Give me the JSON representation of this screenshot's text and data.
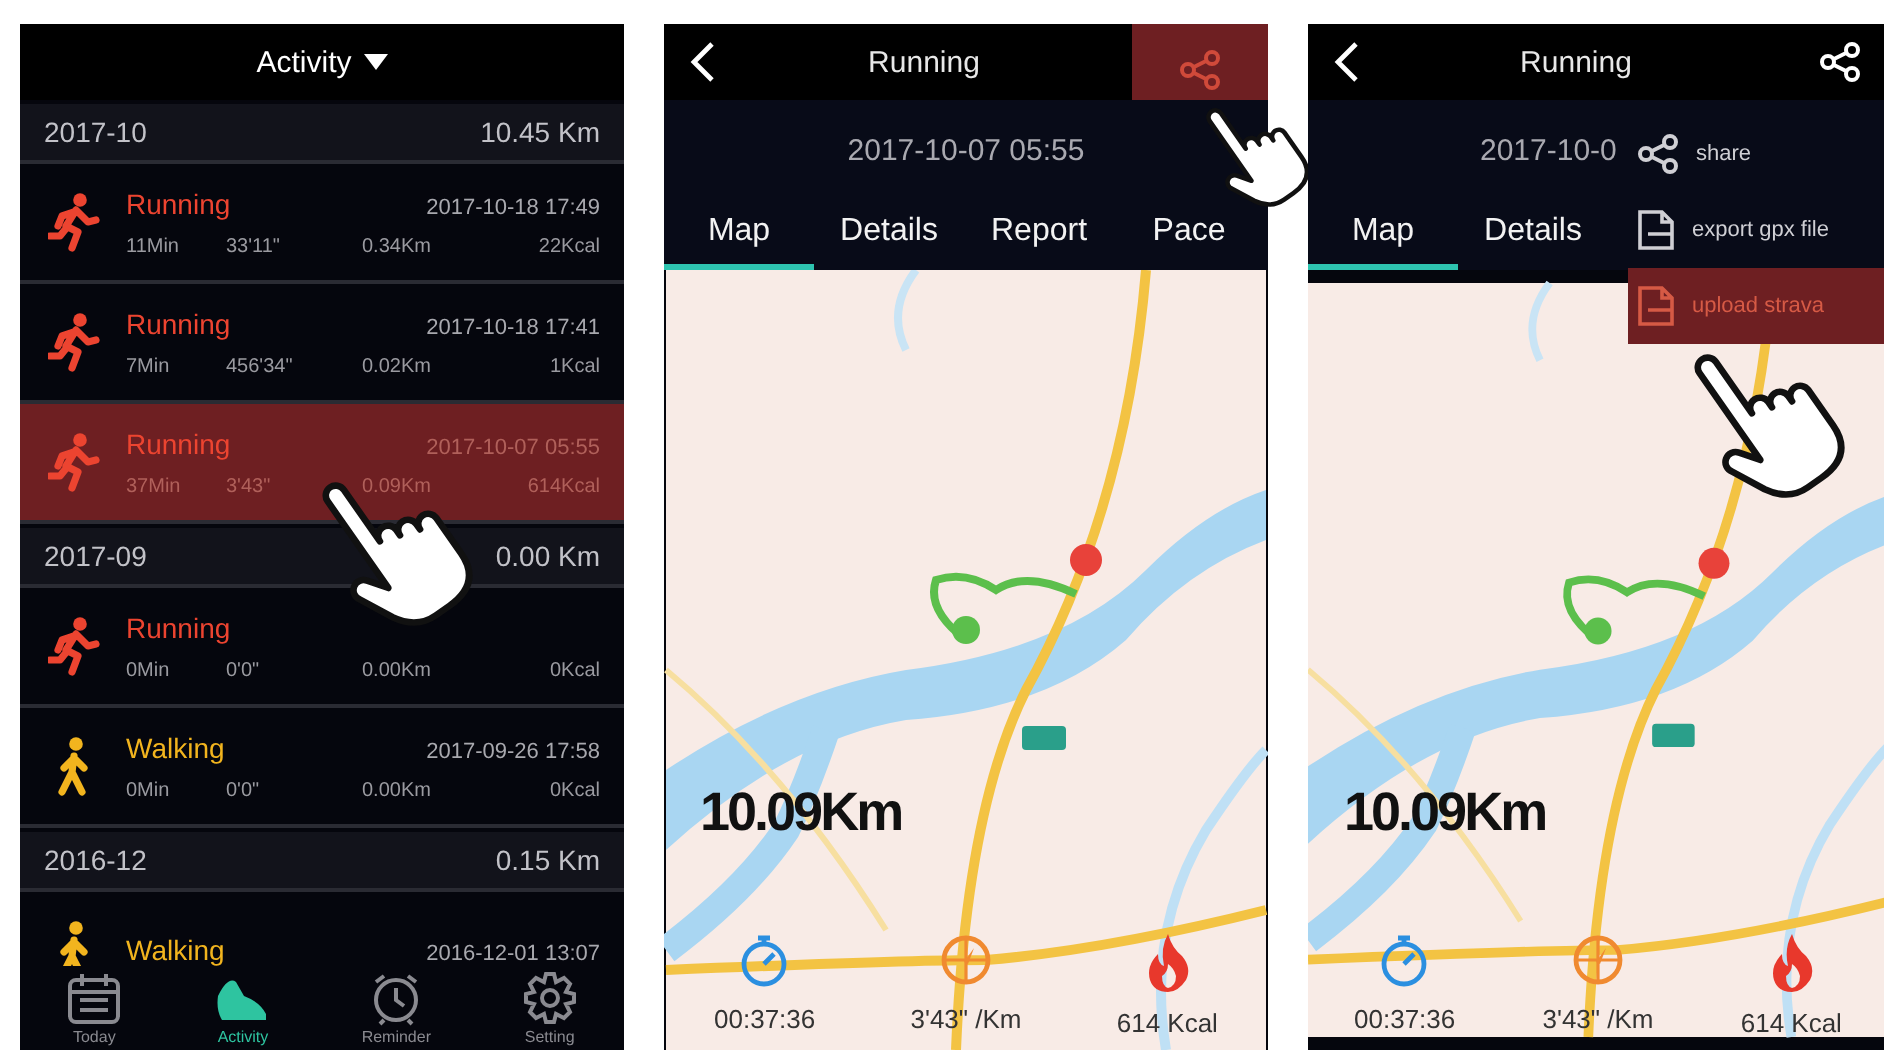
{
  "screens": [
    {
      "kind": "activity_list",
      "title": "Activity",
      "groups": [
        {
          "month": "2017-10",
          "total": "10.45 Km",
          "entries": [
            {
              "kind": "running",
              "name": "Running",
              "date": "2017-10-18 17:49",
              "duration": "11Min",
              "pace": "33'11\"",
              "distance": "0.34Km",
              "calories": "22Kcal",
              "selected": false
            },
            {
              "kind": "running",
              "name": "Running",
              "date": "2017-10-18 17:41",
              "duration": "7Min",
              "pace": "456'34\"",
              "distance": "0.02Km",
              "calories": "1Kcal",
              "selected": false
            },
            {
              "kind": "running",
              "name": "Running",
              "date": "2017-10-07 05:55",
              "duration": "37Min",
              "pace": "3'43\"",
              "distance": "0.09Km",
              "calories": "614Kcal",
              "selected": true
            }
          ]
        },
        {
          "month": "2017-09",
          "total": "0.00 Km",
          "entries": [
            {
              "kind": "running",
              "name": "Running",
              "duration": "0Min",
              "pace": "0'0\"",
              "distance": "0.00Km",
              "calories": "0Kcal",
              "selected": false
            },
            {
              "kind": "walking",
              "name": "Walking",
              "date": "2017-09-26 17:58",
              "duration": "0Min",
              "pace": "0'0\"",
              "distance": "0.00Km",
              "calories": "0Kcal",
              "selected": false
            }
          ]
        },
        {
          "month": "2016-12",
          "total": "0.15 Km",
          "entries": [
            {
              "kind": "walking",
              "name": "Walking",
              "date": "2016-12-01 13:07",
              "selected": false
            }
          ]
        }
      ],
      "tab_bar": [
        {
          "kind": "today",
          "label": "Today",
          "selected": false
        },
        {
          "kind": "activity",
          "label": "Activity",
          "selected": true
        },
        {
          "kind": "reminder",
          "label": "Reminder",
          "selected": false
        },
        {
          "kind": "setting",
          "label": "Setting",
          "selected": false
        }
      ]
    },
    {
      "kind": "detail",
      "title": "Running",
      "share_selected": true,
      "date": "2017-10-07 05:55",
      "tabs": [
        {
          "label": "Map",
          "selected": true
        },
        {
          "label": "Details",
          "selected": false
        },
        {
          "label": "Report",
          "selected": false
        },
        {
          "label": "Pace",
          "selected": false
        }
      ],
      "distance": "10.09Km",
      "stats": [
        {
          "kind": "time",
          "value": "00:37:36"
        },
        {
          "kind": "pace",
          "value": "3'43\" /Km"
        },
        {
          "kind": "calories",
          "value": "614 Kcal"
        }
      ]
    },
    {
      "kind": "detail",
      "title": "Running",
      "share_selected": false,
      "date": "2017-10-0",
      "tabs": [
        {
          "label": "Map",
          "selected": true
        },
        {
          "label": "Details",
          "selected": false
        }
      ],
      "distance": "10.09Km",
      "stats": [
        {
          "kind": "time",
          "value": "00:37:36"
        },
        {
          "kind": "pace",
          "value": "3'43\" /Km"
        },
        {
          "kind": "calories",
          "value": "614 Kcal"
        }
      ],
      "menu": [
        {
          "kind": "share",
          "label": "share",
          "selected": false
        },
        {
          "kind": "export",
          "label": "export gpx file",
          "selected": false
        },
        {
          "kind": "upload",
          "label": "upload strava",
          "selected": true
        }
      ]
    }
  ]
}
